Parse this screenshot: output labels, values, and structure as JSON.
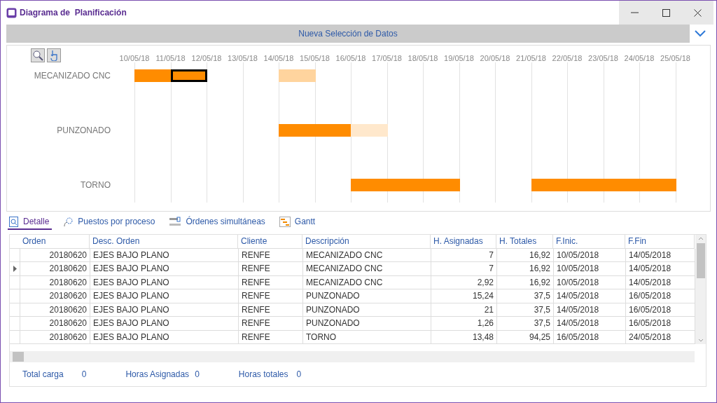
{
  "window": {
    "title": "Diagrama de  Planificación"
  },
  "selection_bar": {
    "label": "Nueva Selección de Datos",
    "expanded": false
  },
  "gantt": {
    "dates": [
      "10/05/18",
      "11/05/18",
      "12/05/18",
      "13/05/18",
      "14/05/18",
      "15/05/18",
      "16/05/18",
      "17/05/18",
      "18/05/18",
      "19/05/18",
      "20/05/18",
      "21/05/18",
      "22/05/18",
      "23/05/18",
      "24/05/18",
      "25/05/18"
    ],
    "lanes": [
      {
        "label": "MECANIZADO CNC",
        "days": [
          {
            "filled": true,
            "color": "#ff8c00",
            "selected": false
          },
          {
            "filled": true,
            "color": "#ff8c00",
            "selected": true
          },
          {
            "filled": false
          },
          {
            "filled": false
          },
          {
            "filled": true,
            "color": "#ffd49e",
            "selected": false
          },
          {
            "filled": false
          },
          {
            "filled": false
          },
          {
            "filled": false
          },
          {
            "filled": false
          },
          {
            "filled": false
          },
          {
            "filled": false
          },
          {
            "filled": false
          },
          {
            "filled": false
          },
          {
            "filled": false
          },
          {
            "filled": false
          }
        ]
      },
      {
        "label": "PUNZONADO",
        "days": [
          {
            "filled": false
          },
          {
            "filled": false
          },
          {
            "filled": false
          },
          {
            "filled": false
          },
          {
            "filled": true,
            "color": "#ff8c00",
            "selected": false
          },
          {
            "filled": true,
            "color": "#ff8c00",
            "selected": false
          },
          {
            "filled": true,
            "color": "#ffe8cc",
            "selected": false
          },
          {
            "filled": false
          },
          {
            "filled": false
          },
          {
            "filled": false
          },
          {
            "filled": false
          },
          {
            "filled": false
          },
          {
            "filled": false
          },
          {
            "filled": false
          },
          {
            "filled": false
          }
        ]
      },
      {
        "label": "TORNO",
        "days": [
          {
            "filled": false
          },
          {
            "filled": false
          },
          {
            "filled": false
          },
          {
            "filled": false
          },
          {
            "filled": false
          },
          {
            "filled": false
          },
          {
            "filled": true,
            "color": "#ff8c00",
            "selected": false
          },
          {
            "filled": true,
            "color": "#ff8c00",
            "selected": false
          },
          {
            "filled": true,
            "color": "#ff8c00",
            "selected": false
          },
          {
            "filled": false
          },
          {
            "filled": false
          },
          {
            "filled": true,
            "color": "#ff8c00",
            "selected": false
          },
          {
            "filled": true,
            "color": "#ff8c00",
            "selected": false
          },
          {
            "filled": true,
            "color": "#ff8c00",
            "selected": false
          },
          {
            "filled": true,
            "color": "#ff8c00",
            "selected": false
          }
        ]
      }
    ]
  },
  "tabs": [
    {
      "label": "Detalle",
      "selected": true
    },
    {
      "label": "Puestos por proceso",
      "selected": false
    },
    {
      "label": "Órdenes simultáneas",
      "selected": false
    },
    {
      "label": "Gantt",
      "selected": false
    }
  ],
  "table": {
    "columns": [
      "Orden",
      "Desc. Orden",
      "Cliente",
      "Descripción",
      "H. Asignadas",
      "H. Totales",
      "F.Inic.",
      "F.Fin"
    ],
    "rows": [
      {
        "selected": false,
        "cells": [
          "20180620",
          "EJES BAJO PLANO",
          "RENFE",
          "MECANIZADO CNC",
          "7",
          "16,92",
          "10/05/2018",
          "14/05/2018"
        ]
      },
      {
        "selected": true,
        "cells": [
          "20180620",
          "EJES BAJO PLANO",
          "RENFE",
          "MECANIZADO CNC",
          "7",
          "16,92",
          "10/05/2018",
          "14/05/2018"
        ]
      },
      {
        "selected": false,
        "cells": [
          "20180620",
          "EJES BAJO PLANO",
          "RENFE",
          "MECANIZADO CNC",
          "2,92",
          "16,92",
          "10/05/2018",
          "14/05/2018"
        ]
      },
      {
        "selected": false,
        "cells": [
          "20180620",
          "EJES BAJO PLANO",
          "RENFE",
          "PUNZONADO",
          "15,24",
          "37,5",
          "14/05/2018",
          "16/05/2018"
        ]
      },
      {
        "selected": false,
        "cells": [
          "20180620",
          "EJES BAJO PLANO",
          "RENFE",
          "PUNZONADO",
          "21",
          "37,5",
          "14/05/2018",
          "16/05/2018"
        ]
      },
      {
        "selected": false,
        "cells": [
          "20180620",
          "EJES BAJO PLANO",
          "RENFE",
          "PUNZONADO",
          "1,26",
          "37,5",
          "14/05/2018",
          "16/05/2018"
        ]
      },
      {
        "selected": false,
        "cells": [
          "20180620",
          "EJES BAJO PLANO",
          "RENFE",
          "TORNO",
          "13,48",
          "94,25",
          "16/05/2018",
          "24/05/2018"
        ]
      }
    ]
  },
  "totals": [
    {
      "label": "Total carga",
      "value": "0"
    },
    {
      "label": "Horas Asignadas",
      "value": "0"
    },
    {
      "label": "Horas totales",
      "value": "0"
    }
  ]
}
